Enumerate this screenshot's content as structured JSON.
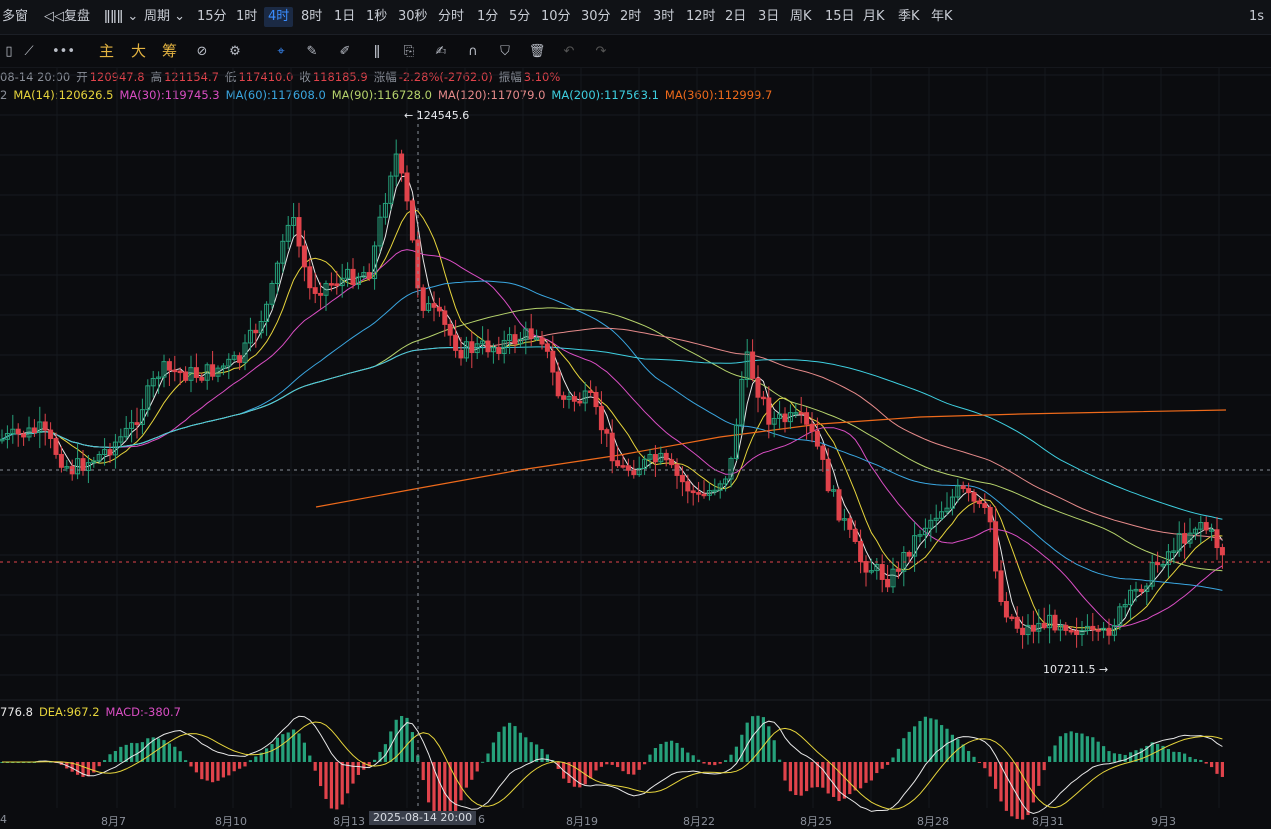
{
  "topbar": {
    "multi_window": "多窗",
    "replay": "复盘",
    "period_label": "周期",
    "periods": [
      "15分",
      "1时",
      "4时",
      "8时",
      "1日",
      "1秒",
      "30秒",
      "分时",
      "1分",
      "5分",
      "10分",
      "30分",
      "2时",
      "3时",
      "12时",
      "2日",
      "3日",
      "周K",
      "15日",
      "月K",
      "季K",
      "年K"
    ],
    "active_period": "4时",
    "right_label": "1s"
  },
  "toolbar": {
    "labels": [
      "主",
      "大",
      "筹"
    ]
  },
  "info": {
    "date": "08-14 20:00",
    "open_label": "开",
    "open": "120947.8",
    "high_label": "高",
    "high": "121154.7",
    "low_label": "低",
    "low": "117410.0",
    "close_label": "收",
    "close": "118185.9",
    "change_label": "涨幅",
    "change": "-2.28%(-2762.0)",
    "amp_label": "振幅",
    "amp": "3.10%"
  },
  "ma": {
    "prefix": "2",
    "ma14": "MA(14):120626.5",
    "ma30": "MA(30):119745.3",
    "ma60": "MA(60):117608.0",
    "ma90": "MA(90):116728.0",
    "ma120": "MA(120):117079.0",
    "ma200": "MA(200):117563.1",
    "ma360": "MA(360):112999.7"
  },
  "macd": {
    "dif": "776.8",
    "dea": "DEA:967.2",
    "macd": "MACD:-380.7"
  },
  "annotations": {
    "high": "124545.6",
    "low": "107211.5"
  },
  "x_ticks": [
    "4",
    "8月7",
    "8月10",
    "8月13",
    "6",
    "8月19",
    "8月22",
    "8月25",
    "8月28",
    "8月31",
    "9月3"
  ],
  "crosshair_label": "2025-08-14 20:00",
  "colors": {
    "up": "#26a17b",
    "down": "#e0434b",
    "ma14": "#e8e8e8",
    "ma30_yellow": "#e6d43c",
    "ma_pink": "#d94ec3",
    "ma_blue": "#3aa6e0",
    "ma_green": "#b6d36c",
    "ma_salmon": "#e58a8a",
    "ma_cyan": "#3ecfe0",
    "ma_orange": "#ee6a1b"
  }
}
